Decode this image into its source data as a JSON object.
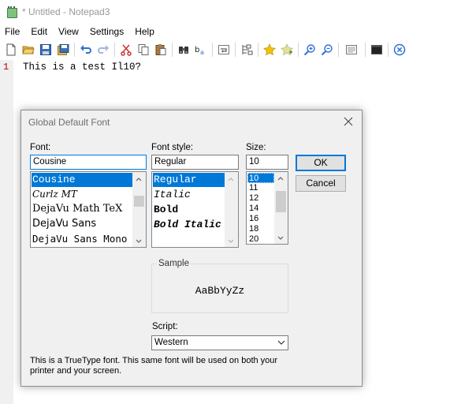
{
  "window": {
    "title": "* Untitled - Notepad3"
  },
  "menu": [
    "File",
    "Edit",
    "View",
    "Settings",
    "Help"
  ],
  "editor": {
    "line_number": "1",
    "text": "This is a test Il10?"
  },
  "dialog": {
    "title": "Global Default Font",
    "font_label": "Font:",
    "font_value": "Cousine",
    "fonts": [
      "Cousine",
      "Curlz MT",
      "DejaVu Math TeX",
      "DejaVu Sans",
      "DejaVu Sans Mono"
    ],
    "style_label": "Font style:",
    "style_value": "Regular",
    "styles": [
      "Regular",
      "Italic",
      "Bold",
      "Bold Italic"
    ],
    "size_label": "Size:",
    "size_value": "10",
    "sizes": [
      "10",
      "11",
      "12",
      "14",
      "16",
      "18",
      "20"
    ],
    "ok_label": "OK",
    "cancel_label": "Cancel",
    "sample_label": "Sample",
    "sample_text": "AaBbYyZz",
    "script_label": "Script:",
    "script_value": "Western",
    "info_line1": "This is a TrueType font. This same font will be used on both your",
    "info_line2": "printer and your screen."
  },
  "colors": {
    "selection": "#0078d7",
    "line_number": "#c00000",
    "star": "#f2c200"
  }
}
